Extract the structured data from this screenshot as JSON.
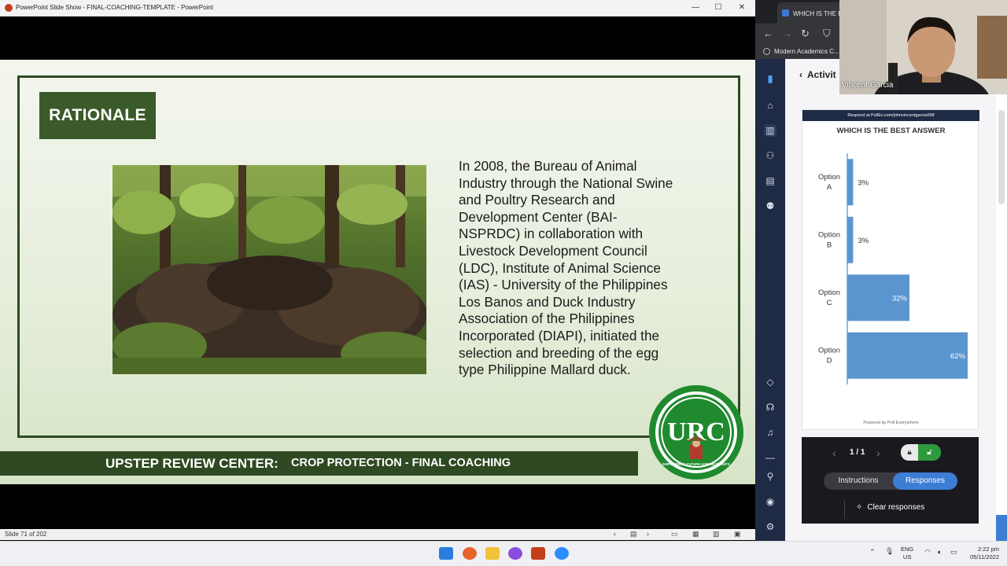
{
  "ppt": {
    "window_title": "PowerPoint Slide Show  -  FINAL-COACHING-TEMPLATE  -  PowerPoint",
    "window_controls": [
      "—",
      "☐",
      "✕"
    ],
    "status_text": "Slide 71 of 202"
  },
  "slide": {
    "heading": "RATIONALE",
    "body": "In 2008, the Bureau of Animal Industry through the National Swine and Poultry Research and Development Center (BAI-NSPRDC) in collaboration with Livestock Development Council (LDC), Institute of Animal Science (IAS) - University of the Philippines Los Banos and Duck Industry Association of the Philippines Incorporated (DIAPI), initiated the selection and breeding of the egg type Philippine Mallard duck.",
    "footer_big": "UPSTEP REVIEW CENTER:",
    "footer_small": "CROP PROTECTION - FINAL COACHING",
    "logo": {
      "letters": "URC",
      "tagline": "EMPOWERING FUTURE AGRICULTURISTS"
    },
    "colors": {
      "dark_green": "#2f4a22",
      "logo_green": "#1f8a2e"
    }
  },
  "browser": {
    "tab_title": "WHICH IS THE B",
    "bookmark": "Modern Academics C..."
  },
  "pollev": {
    "header": "Activit",
    "respond_text": "Respond at PollEv.com/johnvincentgarcia098",
    "question": "WHICH IS THE BEST ANSWER",
    "powered_by": "Powered by  Poll Everywhere",
    "pager": "1 / 1",
    "instructions_label": "Instructions",
    "responses_label": "Responses",
    "clear_label": "Clear responses",
    "accent": "#3d7dd6"
  },
  "chart_data": {
    "type": "bar",
    "orientation": "horizontal",
    "title": "WHICH IS THE BEST ANSWER",
    "categories": [
      "Option A",
      "Option B",
      "Option C",
      "Option D"
    ],
    "values": [
      3,
      3,
      32,
      62
    ],
    "labels": [
      "3%",
      "3%",
      "32%",
      "62%"
    ],
    "xlim": [
      0,
      62
    ],
    "color": "#5b95cf"
  },
  "webcam": {
    "name": "Vincent Garcia"
  },
  "taskbar": {
    "lang_top": "ENG",
    "lang_bottom": "US",
    "time": "2:22 pm",
    "date": "05/11/2022"
  }
}
